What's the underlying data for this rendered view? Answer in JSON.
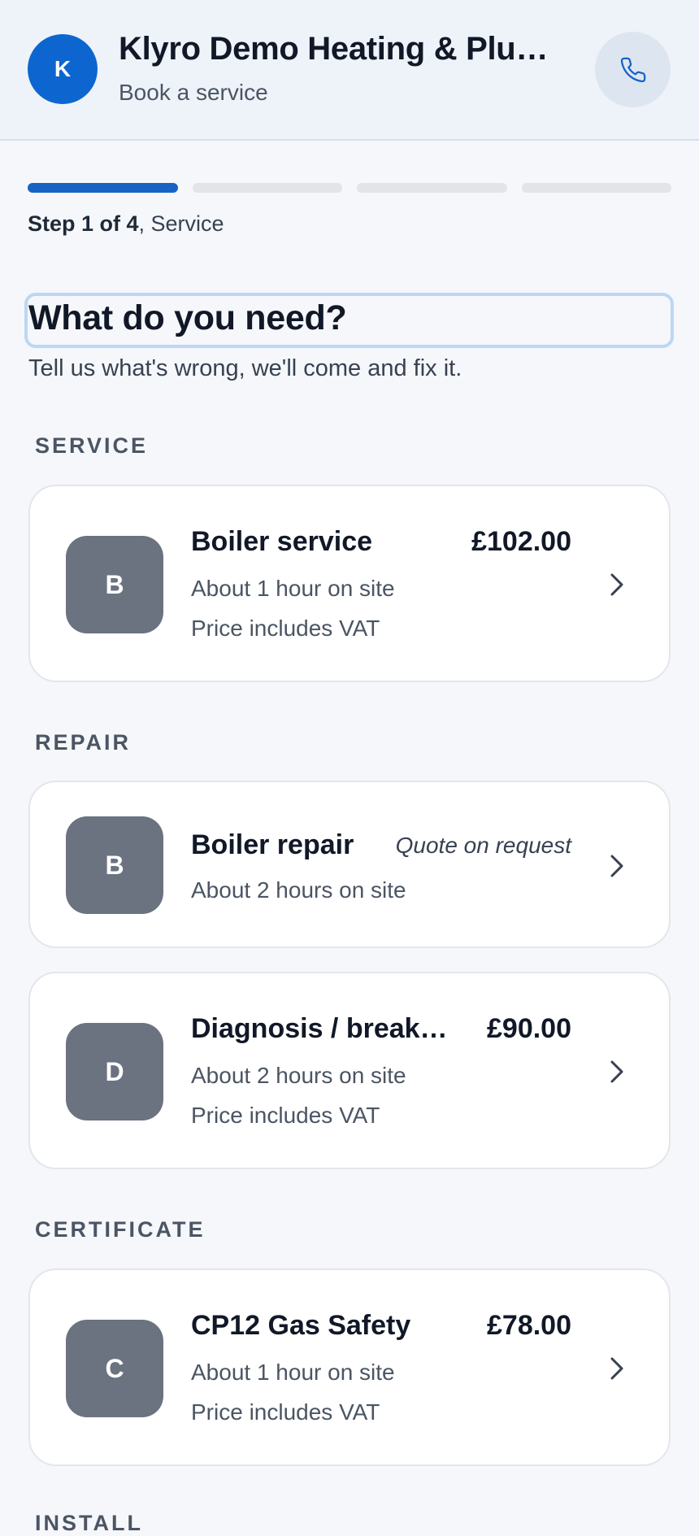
{
  "header": {
    "avatar_letter": "K",
    "business_name": "Klyro Demo Heating & Plum…",
    "subtitle": "Book a service",
    "call_icon": "phone-icon"
  },
  "progress": {
    "current_step": 1,
    "total_steps": 4,
    "step_prefix": "Step 1 of 4",
    "step_name": ", Service"
  },
  "page": {
    "heading": "What do you need?",
    "subheading": "Tell us what's wrong, we'll come and fix it."
  },
  "sections": [
    {
      "label": "SERVICE",
      "items": [
        {
          "letter": "B",
          "title": "Boiler service",
          "price": "£102.00",
          "duration": "About 1 hour on site",
          "vat": "Price includes VAT"
        }
      ]
    },
    {
      "label": "REPAIR",
      "items": [
        {
          "letter": "B",
          "title": "Boiler repair",
          "price": "Quote on request",
          "duration": "About 2 hours on site"
        },
        {
          "letter": "D",
          "title": "Diagnosis / break…",
          "price": "£90.00",
          "duration": "About 2 hours on site",
          "vat": "Price includes VAT"
        }
      ]
    },
    {
      "label": "CERTIFICATE",
      "items": [
        {
          "letter": "C",
          "title": "CP12 Gas Safety",
          "price": "£78.00",
          "duration": "About 1 hour on site",
          "vat": "Price includes VAT"
        }
      ]
    },
    {
      "label": "INSTALL",
      "items": []
    }
  ],
  "colors": {
    "accent": "#1763c4",
    "tile": "#6b7280",
    "background": "#f5f7fa"
  }
}
